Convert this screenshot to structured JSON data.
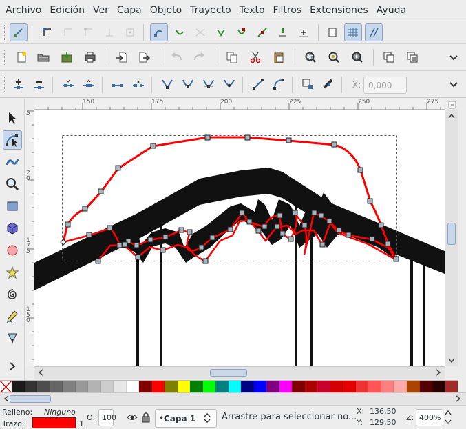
{
  "menu": [
    "Archivo",
    "Edición",
    "Ver",
    "Capa",
    "Objeto",
    "Trayecto",
    "Texto",
    "Filtros",
    "Extensiones",
    "Ayuda"
  ],
  "toolcontrols": {
    "x_label": "X:",
    "x_value": "0,000"
  },
  "rulers": {
    "horizontal": [
      "150",
      "175",
      "200",
      "225",
      "250",
      "275"
    ],
    "vertical": [
      "5",
      "2\n0",
      "1\n7\n5",
      "1\n5\n0"
    ]
  },
  "palette": [
    "#1a1a1a",
    "#333333",
    "#4d4d4d",
    "#666666",
    "#808080",
    "#999999",
    "#b3b3b3",
    "#cccccc",
    "#e6e6e6",
    "#ffffff",
    "#800000",
    "#ff0000",
    "#808000",
    "#ffff00",
    "#008000",
    "#00ff00",
    "#008080",
    "#00ffff",
    "#000080",
    "#0000ff",
    "#800080",
    "#ff00ff",
    "#800000",
    "#aa0000",
    "#c8002c",
    "#d40000",
    "#e00000",
    "#ee3333",
    "#ff5555",
    "#ff8080",
    "#ffaaaa",
    "#aa4400",
    "#550000",
    "#2b0000",
    "#a02c2c"
  ],
  "status": {
    "fill_label": "Relleno:",
    "fill_value": "Ninguno",
    "stroke_label": "Trazo:",
    "stroke_width": "1",
    "opacity_label": "O:",
    "opacity_value": "100",
    "layer": "Capa 1",
    "message": "Arrastre para seleccionar no...",
    "x_label": "X:",
    "x_value": "136,50",
    "y_label": "Y:",
    "y_value": "129,50",
    "zoom_label": "Z:",
    "zoom_value": "400%"
  },
  "colors": {
    "stroke": "#ff0000",
    "accent": "#8aa4c8",
    "active_bg": "#c8d8ea"
  }
}
